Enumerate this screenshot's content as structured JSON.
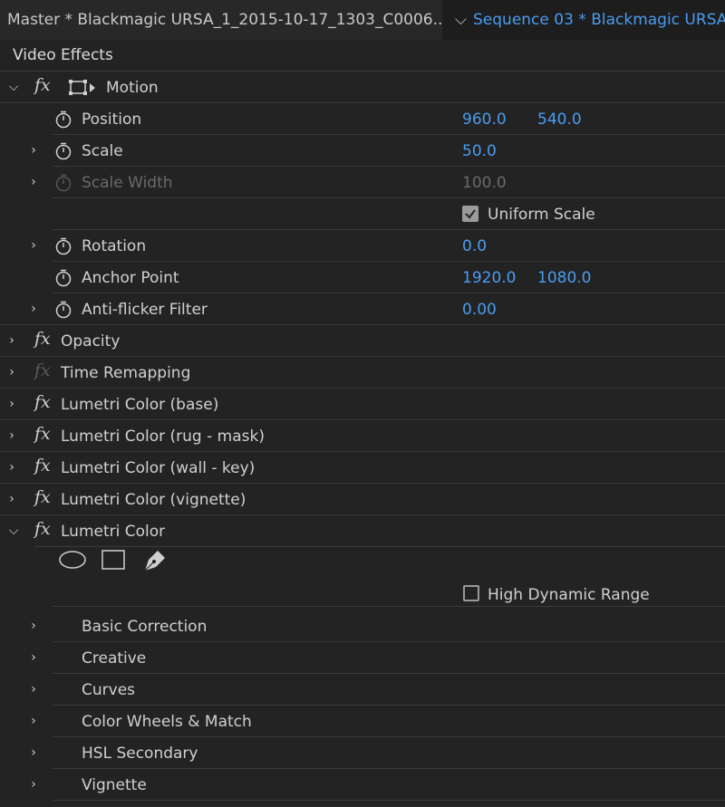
{
  "tabs": {
    "master_label": "Master * Blackmagic URSA_1_2015-10-17_1303_C0006....",
    "sequence_label": "Sequence 03 * Blackmagic URSA_"
  },
  "section_title": "Video Effects",
  "motion": {
    "title": "Motion",
    "position": {
      "label": "Position",
      "x": "960.0",
      "y": "540.0"
    },
    "scale": {
      "label": "Scale",
      "value": "50.0"
    },
    "scale_width": {
      "label": "Scale Width",
      "value": "100.0"
    },
    "uniform_scale": {
      "label": "Uniform Scale",
      "checked": true
    },
    "rotation": {
      "label": "Rotation",
      "value": "0.0"
    },
    "anchor_point": {
      "label": "Anchor Point",
      "x": "1920.0",
      "y": "1080.0"
    },
    "anti_flicker": {
      "label": "Anti-flicker Filter",
      "value": "0.00"
    }
  },
  "effects": [
    {
      "label": "Opacity"
    },
    {
      "label": "Time Remapping"
    },
    {
      "label": "Lumetri Color (base)"
    },
    {
      "label": "Lumetri Color (rug - mask)"
    },
    {
      "label": "Lumetri Color (wall - key)"
    },
    {
      "label": "Lumetri Color (vignette)"
    },
    {
      "label": "Lumetri Color"
    }
  ],
  "lumetri": {
    "hdr_label": "High Dynamic Range",
    "hdr_checked": false,
    "subsections": [
      {
        "label": "Basic Correction"
      },
      {
        "label": "Creative"
      },
      {
        "label": "Curves"
      },
      {
        "label": "Color Wheels & Match"
      },
      {
        "label": "HSL Secondary"
      },
      {
        "label": "Vignette"
      }
    ]
  },
  "icons": {
    "twisty_open": "chevron-down-icon",
    "twisty_closed": "chevron-right-icon",
    "stopwatch": "stopwatch-icon",
    "fx": "fx-icon"
  },
  "colors": {
    "accent_blue": "#4a9cf0",
    "panel_bg": "#232323",
    "divider": "#3a3a3a"
  }
}
